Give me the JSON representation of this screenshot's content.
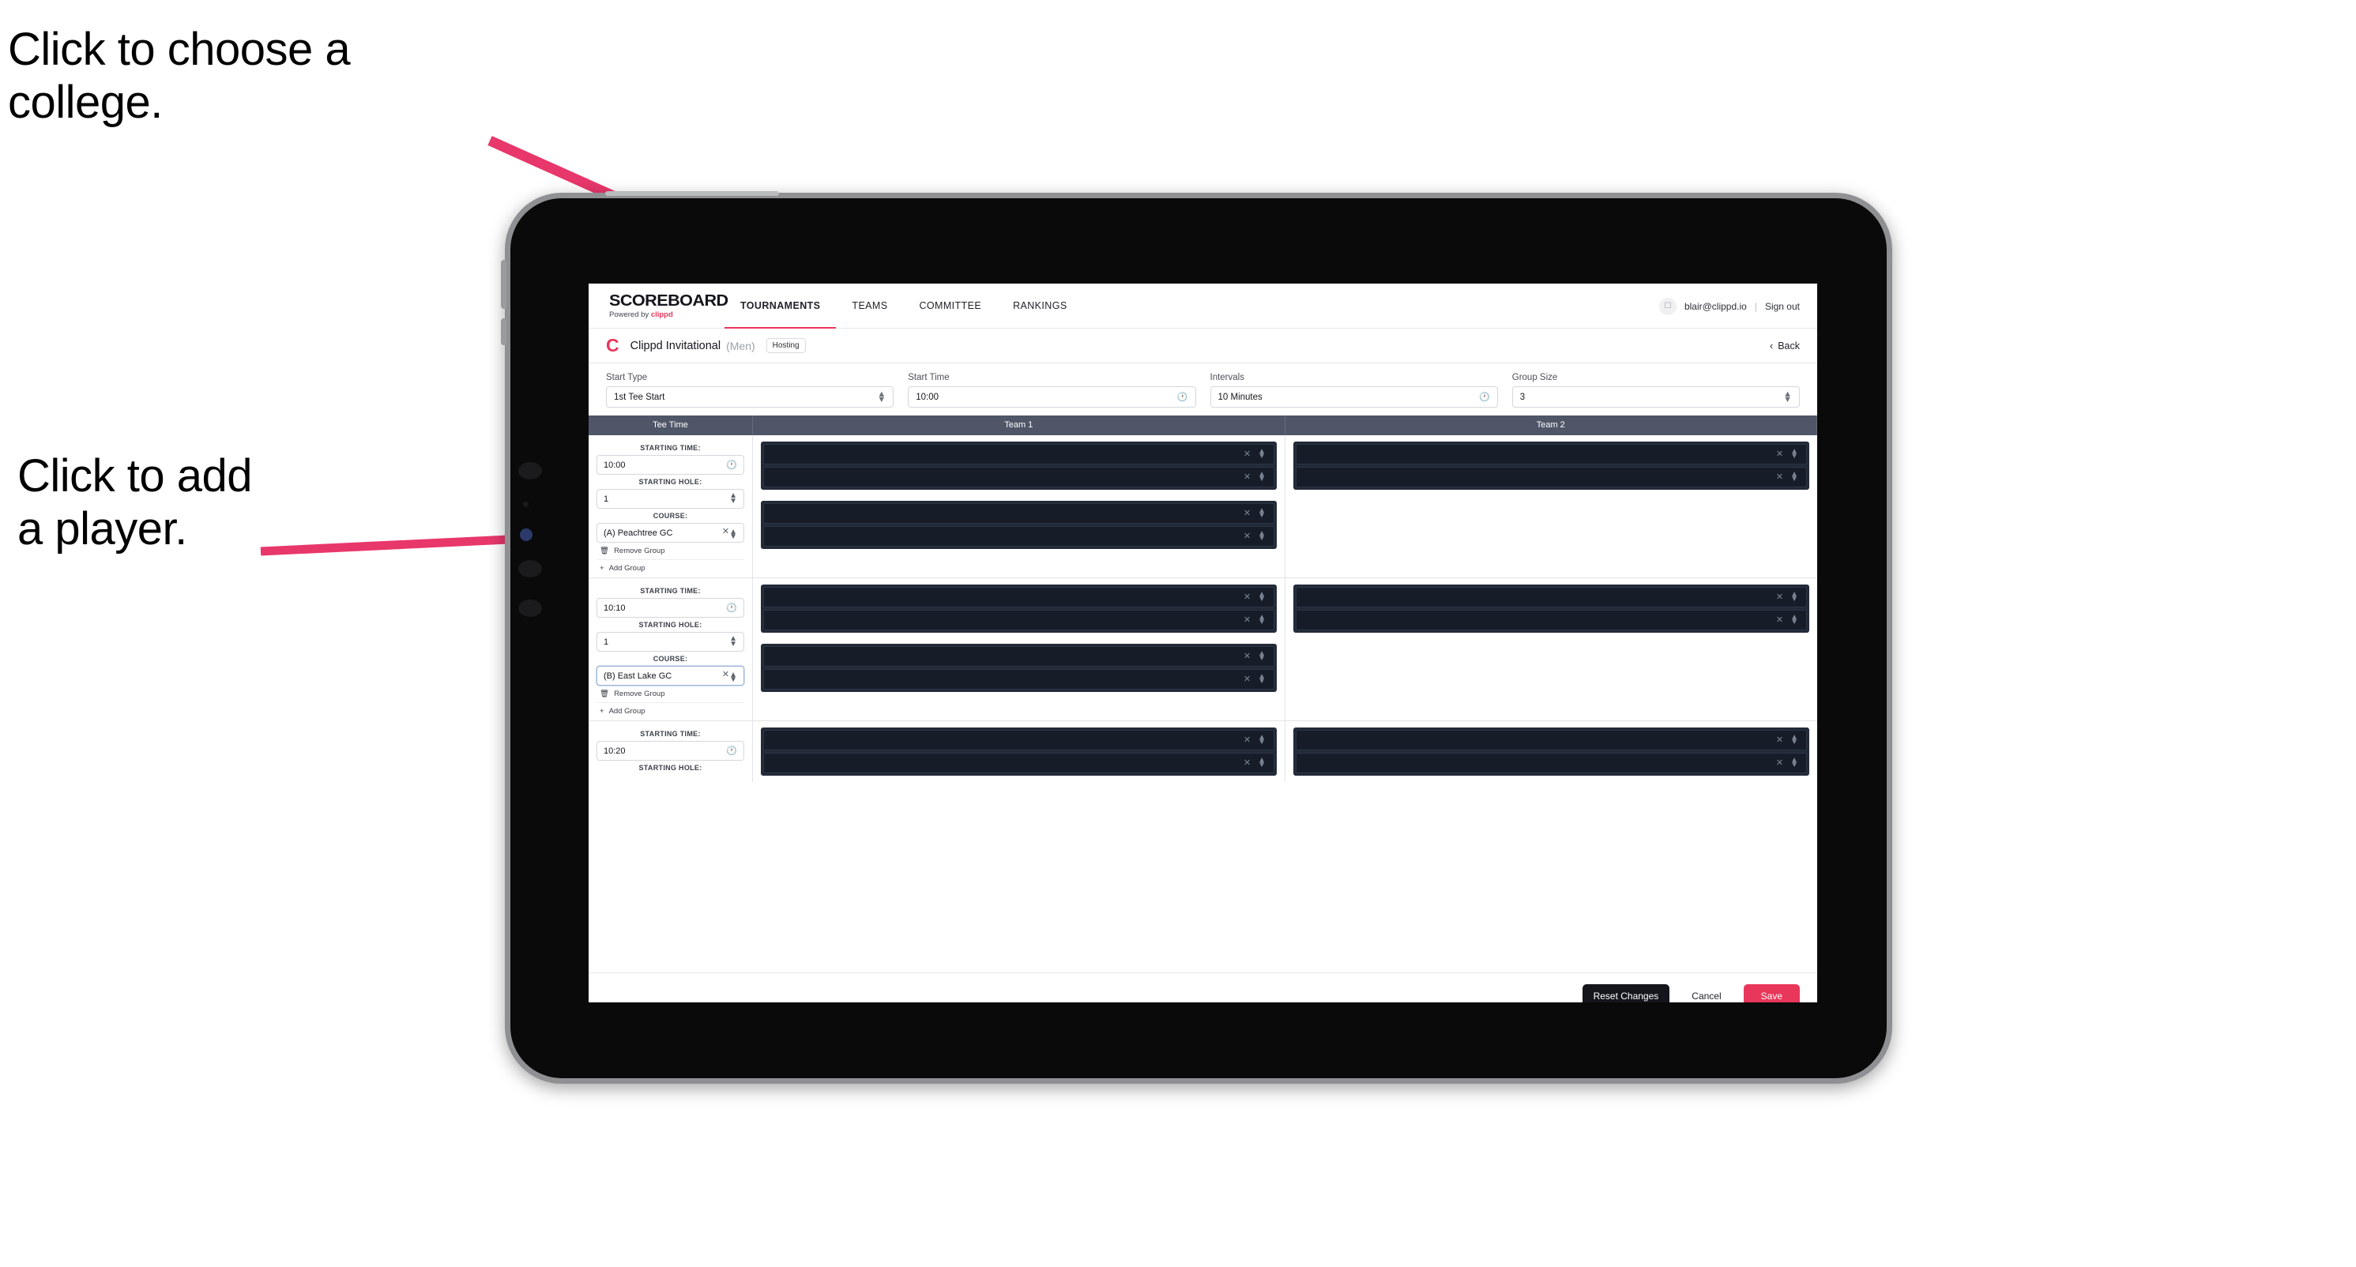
{
  "annotations": {
    "choose_college": "Click to choose a\ncollege.",
    "add_player": "Click to add\na player."
  },
  "colors": {
    "accent": "#e8375a",
    "header_band": "#4e5668",
    "slot_dark": "#161d29"
  },
  "nav": {
    "brand": {
      "wordmark": "SCOREBOARD",
      "powered_prefix": "Powered by ",
      "powered_brand": "clippd"
    },
    "links": [
      {
        "label": "TOURNAMENTS",
        "active": true
      },
      {
        "label": "TEAMS",
        "active": false
      },
      {
        "label": "COMMITTEE",
        "active": false
      },
      {
        "label": "RANKINGS",
        "active": false
      }
    ],
    "user": {
      "avatar_icon": "user-icon",
      "email": "blair@clippd.io",
      "separator": "|",
      "sign_out": "Sign out"
    }
  },
  "tournament": {
    "logo": "C",
    "name": "Clippd Invitational",
    "gender": "(Men)",
    "role_badge": "Hosting",
    "back_label": "Back",
    "back_icon": "chevron-left-icon"
  },
  "settings": [
    {
      "label": "Start Type",
      "value": "1st Tee Start",
      "adorn": "spinner"
    },
    {
      "label": "Start Time",
      "value": "10:00",
      "adorn": "clock"
    },
    {
      "label": "Intervals",
      "value": "10 Minutes",
      "adorn": "clock"
    },
    {
      "label": "Group Size",
      "value": "3",
      "adorn": "spinner"
    }
  ],
  "table": {
    "columns": [
      "Tee Time",
      "Team 1",
      "Team 2"
    ],
    "labels": {
      "starting_time": "STARTING TIME:",
      "starting_hole": "STARTING HOLE:",
      "course": "COURSE:"
    },
    "actions": {
      "remove_group": "Remove Group",
      "add_group": "Add Group",
      "remove_icon": "trash-icon",
      "add_icon": "plus-icon"
    },
    "groups": [
      {
        "starting_time": "10:00",
        "starting_hole": "1",
        "course": "(A) Peachtree GC",
        "course_focused": false,
        "team1_slots": 2,
        "team1_extra_slots": 2,
        "team2_slots": 2,
        "team2_extra_slots": 0
      },
      {
        "starting_time": "10:10",
        "starting_hole": "1",
        "course": "(B) East Lake GC",
        "course_focused": true,
        "team1_slots": 2,
        "team1_extra_slots": 2,
        "team2_slots": 2,
        "team2_extra_slots": 0
      },
      {
        "starting_time": "10:20",
        "starting_hole": "",
        "course": "",
        "course_focused": false,
        "team1_slots": 2,
        "team1_extra_slots": 0,
        "team2_slots": 2,
        "team2_extra_slots": 0
      }
    ]
  },
  "footer": {
    "reset": "Reset Changes",
    "cancel": "Cancel",
    "save": "Save"
  }
}
